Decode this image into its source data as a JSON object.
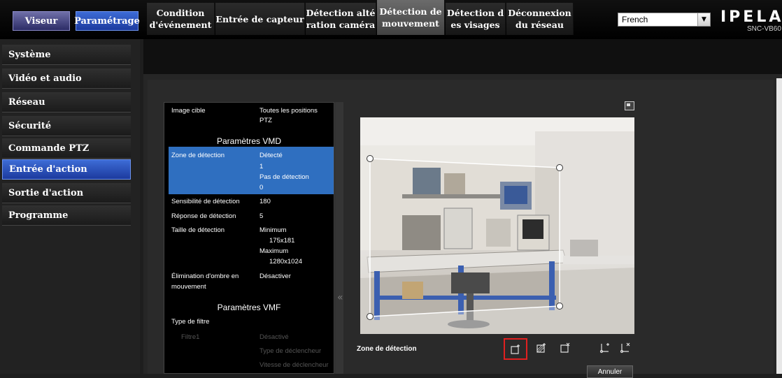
{
  "topbar": {
    "viseur": "Viseur",
    "parametrage": "Paramétrage",
    "language": "French",
    "logo": "IPELA",
    "model": "SNC-VB60"
  },
  "sidebar": {
    "items": [
      {
        "label": "Système"
      },
      {
        "label": "Vidéo et audio"
      },
      {
        "label": "Réseau"
      },
      {
        "label": "Sécurité"
      },
      {
        "label": "Commande PTZ"
      },
      {
        "label": "Entrée d'action"
      },
      {
        "label": "Sortie d'action"
      },
      {
        "label": "Programme"
      }
    ],
    "active_index": 5
  },
  "tabs": [
    {
      "line1": "Condition",
      "line2": "d'événement"
    },
    {
      "line1": "Entrée de capteur",
      "line2": ""
    },
    {
      "line1": "Détection alté",
      "line2": "ration caméra"
    },
    {
      "line1": "Détection de",
      "line2": "mouvement"
    },
    {
      "line1": "Détection d",
      "line2": "es visages"
    },
    {
      "line1": "Déconnexion",
      "line2": "du réseau"
    }
  ],
  "panel": {
    "image_cible_label": "Image cible",
    "image_cible_value1": "Toutes les positions",
    "image_cible_value2": "PTZ",
    "vmd_header": "Paramètres VMD",
    "zone_label": "Zone de détection",
    "zone_detecte": "Détecté",
    "zone_detecte_val": "1",
    "zone_pas": "Pas de détection",
    "zone_pas_val": "0",
    "sensibilite_label": "Sensibilité de détection",
    "sensibilite_val": "180",
    "reponse_label": "Réponse de détection",
    "reponse_val": "5",
    "taille_label": "Taille de détection",
    "taille_min_label": "Minimum",
    "taille_min_val": "175x181",
    "taille_max_label": "Maximum",
    "taille_max_val": "1280x1024",
    "ombre_label1": "Élimination d'ombre en",
    "ombre_label2": "mouvement",
    "ombre_val": "Désactiver",
    "vmf_header": "Paramètres VMF",
    "filtre_label": "Type de filtre",
    "filtre1": "Filtre1",
    "filtre1_val": "Désactivé",
    "type_decl": "Type de déclencheur",
    "vitesse_decl": "Vitesse de déclencheur"
  },
  "detection": {
    "zone_label": "Zone de détection",
    "cancel": "Annuler"
  },
  "colors": {
    "accent_blue": "#2f6fc0",
    "highlight_red": "#e02020"
  }
}
